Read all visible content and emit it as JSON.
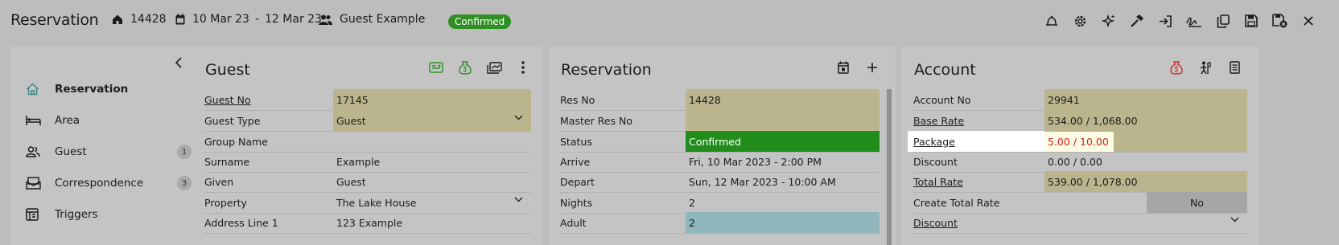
{
  "header": {
    "title": "Reservation",
    "res_no": "14428",
    "date_from": "10 Mar 23",
    "date_sep": "-",
    "date_to": "12 Mar 23",
    "guest_name": "Guest Example",
    "status_badge": "Confirmed",
    "toolbar_icons": [
      "bell-icon",
      "gear-icon",
      "sparkle-icon",
      "hammer-icon",
      "check-in-icon",
      "signature-icon",
      "copy-icon",
      "save-icon",
      "save-close-icon",
      "close-icon"
    ]
  },
  "sidebar": {
    "items": [
      {
        "label": "Reservation",
        "icon": "home-icon",
        "active": true
      },
      {
        "label": "Area",
        "icon": "bed-icon"
      },
      {
        "label": "Guest",
        "icon": "users-icon",
        "count": "1"
      },
      {
        "label": "Correspondence",
        "icon": "mail-icon",
        "count": "3"
      },
      {
        "label": "Triggers",
        "icon": "triggers-icon"
      }
    ]
  },
  "guest": {
    "title": "Guest",
    "rows": [
      {
        "label": "Guest No",
        "value": "17145"
      },
      {
        "label": "Guest Type",
        "value": "Guest"
      },
      {
        "label": "Group Name",
        "value": ""
      },
      {
        "label": "Surname",
        "value": "Example"
      },
      {
        "label": "Given",
        "value": "Guest"
      },
      {
        "label": "Property",
        "value": "The Lake House"
      },
      {
        "label": "Address Line 1",
        "value": "123 Example"
      }
    ]
  },
  "reservation": {
    "title": "Reservation",
    "rows": [
      {
        "label": "Res No",
        "value": "14428"
      },
      {
        "label": "Master Res No",
        "value": ""
      },
      {
        "label": "Status",
        "value": "Confirmed"
      },
      {
        "label": "Arrive",
        "value": "Fri, 10 Mar 2023 - 2:00 PM"
      },
      {
        "label": "Depart",
        "value": "Sun, 12 Mar 2023 - 10:00 AM"
      },
      {
        "label": "Nights",
        "value": "2"
      },
      {
        "label": "Adult",
        "value": "2"
      }
    ]
  },
  "account": {
    "title": "Account",
    "rows": [
      {
        "label": "Account No",
        "value": "29941"
      },
      {
        "label": "Base Rate",
        "value": "534.00 / 1,068.00"
      },
      {
        "label": "Package",
        "value": "5.00 / 10.00"
      },
      {
        "label": "Discount",
        "value": "0.00 / 0.00"
      },
      {
        "label": "Total Rate",
        "value": "539.00 / 1,078.00"
      },
      {
        "label": "Create Total Rate",
        "value": "No"
      },
      {
        "label": "Discount",
        "value": ""
      }
    ]
  },
  "colors": {
    "confirmed": "#218d1a",
    "highlight_red": "#d62020",
    "accent_green": "#2f8f24"
  }
}
